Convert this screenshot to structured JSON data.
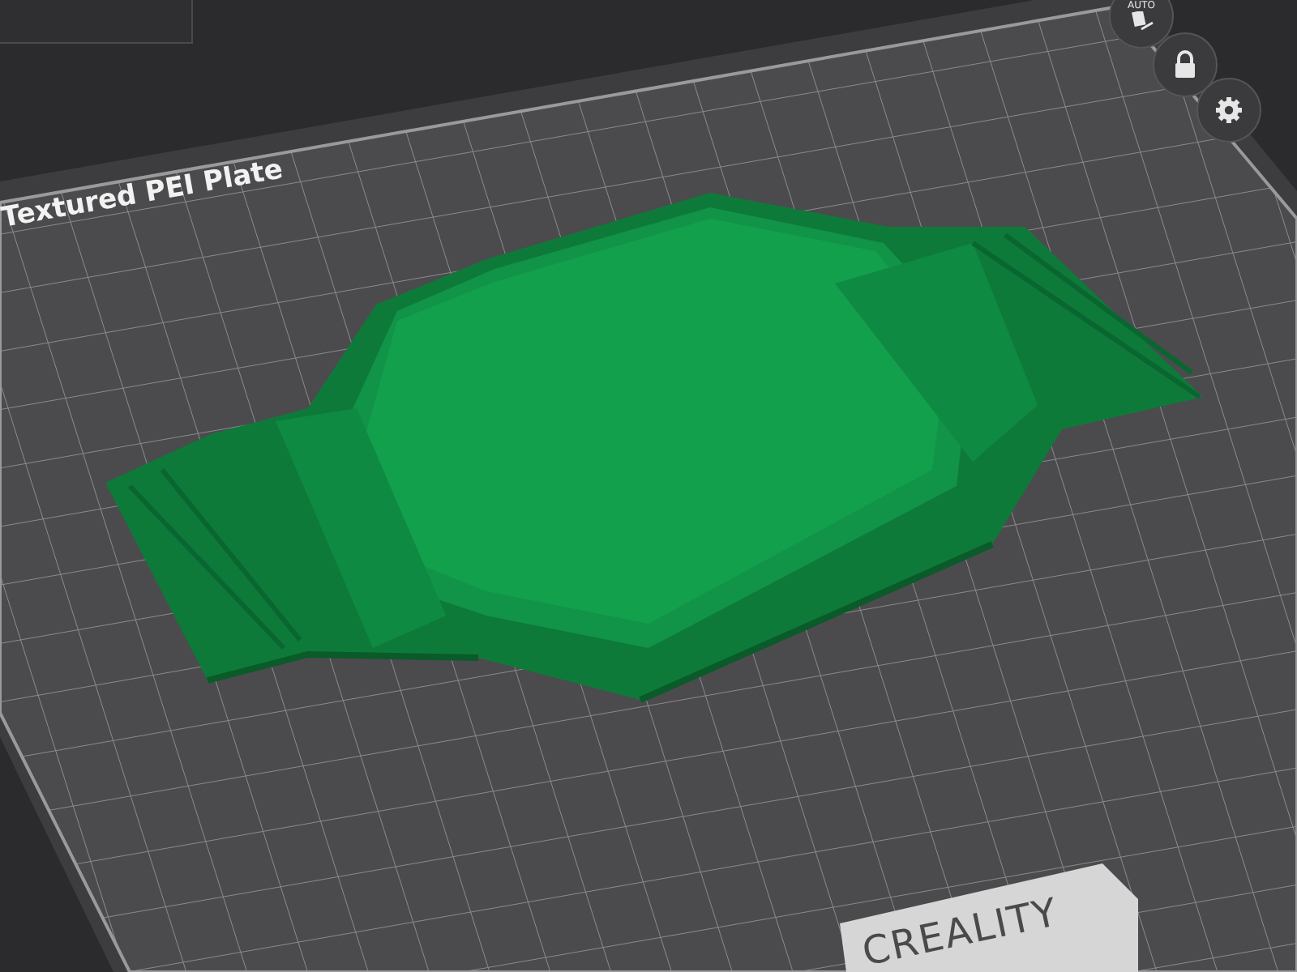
{
  "plate": {
    "label": "Textured PEI Plate",
    "logo": "CREALITY"
  },
  "view_buttons": [
    {
      "kind": "auto",
      "label": "AUTO"
    },
    {
      "kind": "lock"
    },
    {
      "kind": "settings"
    }
  ]
}
